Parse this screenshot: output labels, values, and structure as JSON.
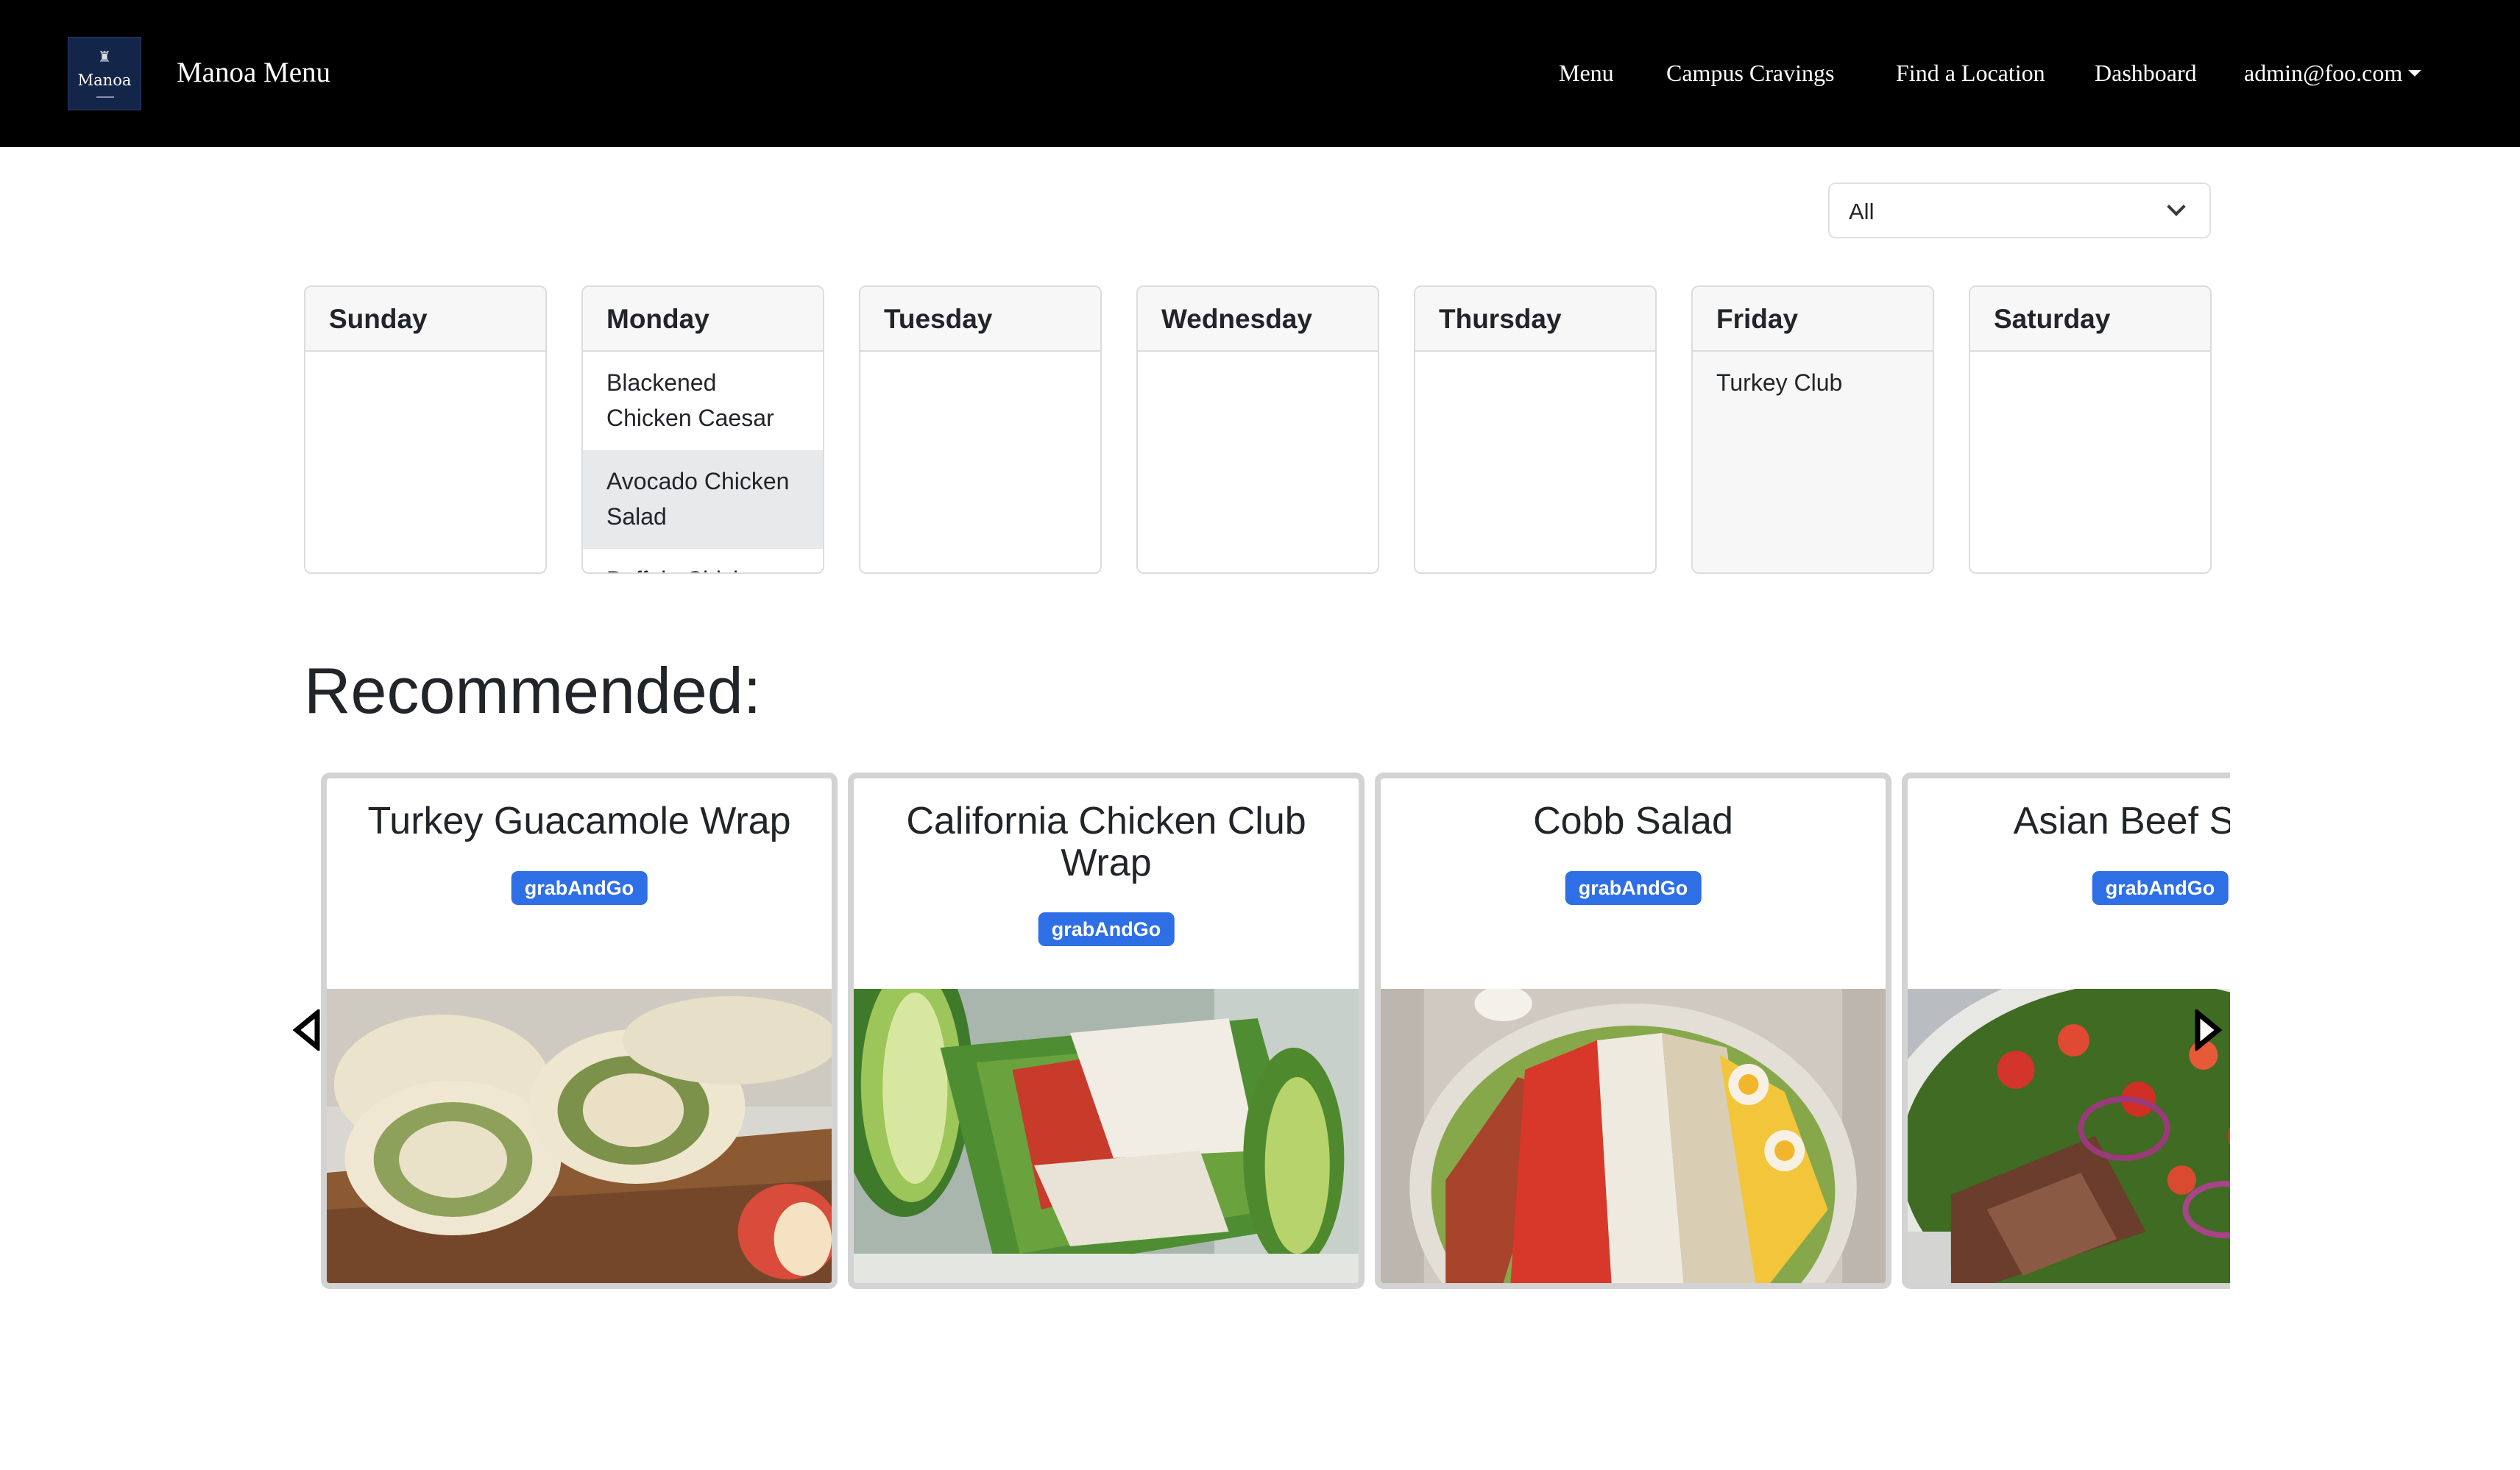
{
  "navbar": {
    "logo_text": "Manoa",
    "brand": "Manoa Menu",
    "links": {
      "menu": "Menu",
      "campus_cravings": "Campus Cravings",
      "find_location": "Find a Location",
      "dashboard": "Dashboard"
    },
    "user": "admin@foo.com",
    "background": "#000000"
  },
  "filter": {
    "selected": "All"
  },
  "week": {
    "days": [
      {
        "name": "Sunday",
        "items": []
      },
      {
        "name": "Monday",
        "items": [
          "Blackened Chicken Caesar",
          "Avocado Chicken Salad",
          "Buffalo Chicken"
        ]
      },
      {
        "name": "Tuesday",
        "items": []
      },
      {
        "name": "Wednesday",
        "items": []
      },
      {
        "name": "Thursday",
        "items": []
      },
      {
        "name": "Friday",
        "items": [
          "Turkey Club"
        ]
      },
      {
        "name": "Saturday",
        "items": []
      }
    ]
  },
  "recommended": {
    "heading": "Recommended:",
    "badge_color": "#2f6fe6",
    "cards": [
      {
        "title": "Turkey Guacamole Wrap",
        "tag": "grabAndGo",
        "image": "wrap-photo"
      },
      {
        "title": "California Chicken Club Wrap",
        "tag": "grabAndGo",
        "image": "club-wrap-photo"
      },
      {
        "title": "Cobb Salad",
        "tag": "grabAndGo",
        "image": "cobb-salad-photo"
      },
      {
        "title": "Asian Beef Salad",
        "tag": "grabAndGo",
        "image": "beef-salad-photo"
      }
    ],
    "prev_icon": "triangle-left-icon",
    "next_icon": "triangle-right-icon"
  }
}
